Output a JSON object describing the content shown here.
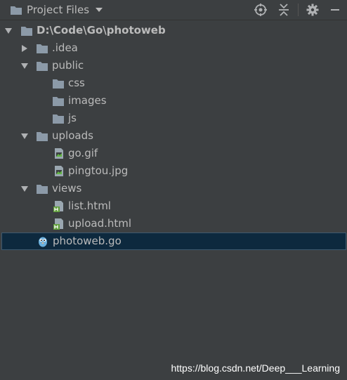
{
  "header": {
    "title": "Project Files",
    "icons": [
      "folder-icon",
      "dropdown-caret-icon",
      "locate-icon",
      "collapse-all-icon",
      "gear-icon",
      "minimize-icon"
    ]
  },
  "tree": {
    "items": [
      {
        "label": "D:\\Code\\Go\\photoweb",
        "type": "folder",
        "expanded": true
      },
      {
        "label": ".idea",
        "type": "folder",
        "expanded": false
      },
      {
        "label": "public",
        "type": "folder",
        "expanded": true
      },
      {
        "label": "css",
        "type": "folder"
      },
      {
        "label": "images",
        "type": "folder"
      },
      {
        "label": "js",
        "type": "folder"
      },
      {
        "label": "uploads",
        "type": "folder",
        "expanded": true
      },
      {
        "label": "go.gif",
        "type": "image-file"
      },
      {
        "label": "pingtou.jpg",
        "type": "image-file"
      },
      {
        "label": "views",
        "type": "folder",
        "expanded": true
      },
      {
        "label": "list.html",
        "type": "html-file"
      },
      {
        "label": "upload.html",
        "type": "html-file"
      },
      {
        "label": "photoweb.go",
        "type": "go-file",
        "selected": true
      }
    ]
  },
  "colors": {
    "background": "#3c3f41",
    "text": "#bbbbbb",
    "folder": "#8c9aa8",
    "selection": "#0d293e",
    "html_badge": "#5f9e3a",
    "go_gopher": "#6ab0de"
  },
  "watermark": "https://blog.csdn.net/Deep___Learning"
}
